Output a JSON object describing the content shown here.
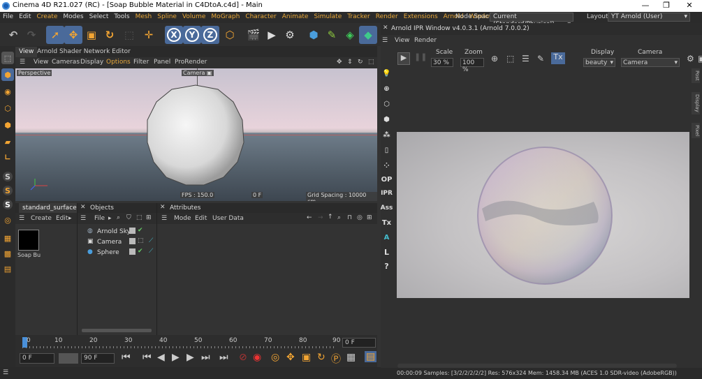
{
  "app": {
    "title": "Cinema 4D R21.027 (RC) - [Soap Bubble Material in C4DtoA.c4d] - Main",
    "window_buttons": [
      "—",
      "❐",
      "✕"
    ]
  },
  "menubar": {
    "items": [
      "File",
      "Edit",
      "Create",
      "Modes",
      "Select",
      "Tools",
      "Mesh",
      "Spline",
      "Volume",
      "MoGraph",
      "Character",
      "Animate",
      "Simulate",
      "Tracker",
      "Render",
      "Extensions",
      "Arnold",
      "Window"
    ],
    "node_space_label": "Node Space:",
    "node_space_value": "Current (Standard/Physical)",
    "layout_label": "Layout:",
    "layout_value": "YT Arnold (User)",
    "colors": {
      "menu_highlight": "#e8a83a",
      "accent": "#4a90d9"
    }
  },
  "viewport": {
    "tabs": [
      "View",
      "Arnold Shader Network Editor"
    ],
    "menu": [
      "View",
      "Cameras",
      "Display",
      "Options",
      "Filter",
      "Panel",
      "ProRender"
    ],
    "label": "Perspective",
    "camera_label": "Camera",
    "fps": "FPS : 150.0",
    "frame": "0 F",
    "grid_spacing": "Grid Spacing : 10000 cm"
  },
  "material": {
    "tab": "standard_surface",
    "menu": [
      "Create",
      "Edit"
    ],
    "name": "Soap Bu"
  },
  "objects": {
    "tab": "Objects",
    "menu": [
      "File"
    ],
    "rows": [
      {
        "name": "Arnold Sky",
        "icon": "sky-icon"
      },
      {
        "name": "Camera",
        "icon": "camera-icon"
      },
      {
        "name": "Sphere",
        "icon": "sphere-icon"
      }
    ]
  },
  "attributes": {
    "tab": "Attributes",
    "menu": [
      "Mode",
      "Edit",
      "User Data"
    ]
  },
  "timeline": {
    "ticks": [
      "0",
      "10",
      "20",
      "30",
      "40",
      "50",
      "60",
      "70",
      "80",
      "90"
    ],
    "current": "0 F"
  },
  "transport": {
    "start": "0 F",
    "end": "90 F"
  },
  "ipr": {
    "title": "Arnold IPR Window v4.0.3.1 (Arnold 7.0.0.2)",
    "menu": [
      "View",
      "Render"
    ],
    "scale_label": "Scale",
    "scale_value": "30 %",
    "zoom_label": "Zoom",
    "zoom_value": "100 %",
    "display_label": "Display",
    "display_value": "beauty",
    "camera_label": "Camera",
    "camera_value": "Camera",
    "tx_label": "Tx",
    "side_tabs": [
      "Post",
      "Display",
      "Pixel"
    ],
    "left_tools": [
      "OP",
      "IPR",
      "Ass",
      "Tx",
      "L",
      "?"
    ],
    "status": "00:00:09  Samples: [3/2/2/2/2/2]  Res: 576x324  Mem: 1458.34 MB  (ACES 1.0 SDR-video (AdobeRGB))"
  }
}
